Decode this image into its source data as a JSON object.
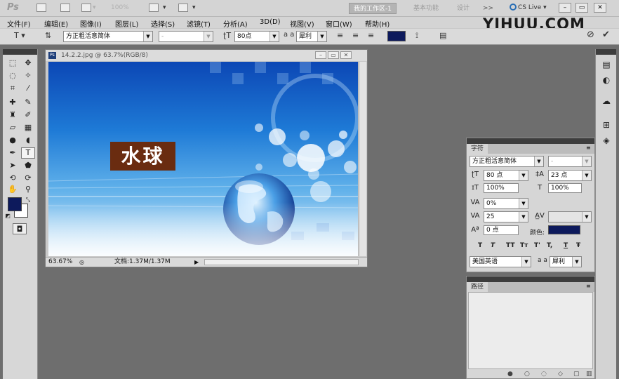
{
  "appbar": {
    "logo": "Ps",
    "zoom": "100%",
    "workspaces": [
      "我的工作区-1",
      "基本功能",
      "设计"
    ],
    "more": ">>",
    "cslive": "CS Live"
  },
  "menu": [
    "文件(F)",
    "编辑(E)",
    "图像(I)",
    "图层(L)",
    "选择(S)",
    "滤镜(T)",
    "分析(A)",
    "3D(D)",
    "视图(V)",
    "窗口(W)",
    "帮助(H)"
  ],
  "watermark": "YIHUU.COM",
  "options": {
    "font_family": "方正粗活意简体",
    "font_style": "-",
    "font_size": "80点",
    "aa_label": "a a",
    "aa_method": "犀利",
    "text_color": "#0d1a5c"
  },
  "document": {
    "title": "14.2.2.jpg @ 63.7%(RGB/8)",
    "art_text": "水球",
    "zoom": "63.67%",
    "doc_size": "文档:1.37M/1.37M"
  },
  "tools": {
    "foreground": "#0d1a5c",
    "background": "#ffffff"
  },
  "character_panel": {
    "tab": "字符",
    "font_family": "方正粗活意简体",
    "font_style": "-",
    "size": "80 点",
    "leading": "23 点",
    "vscale": "100%",
    "hscale": "100%",
    "kerning": "0%",
    "tracking": "25",
    "baseline": "0 点",
    "color_label": "颜色:",
    "color": "#0d1a5c",
    "style_buttons": [
      "T",
      "T",
      "TT",
      "Tт",
      "T'",
      "T,",
      "T",
      "Ŧ"
    ],
    "language": "美国英语",
    "aa_label": "a a",
    "aa_method": "犀利"
  },
  "paths_panel": {
    "tab": "路径"
  }
}
